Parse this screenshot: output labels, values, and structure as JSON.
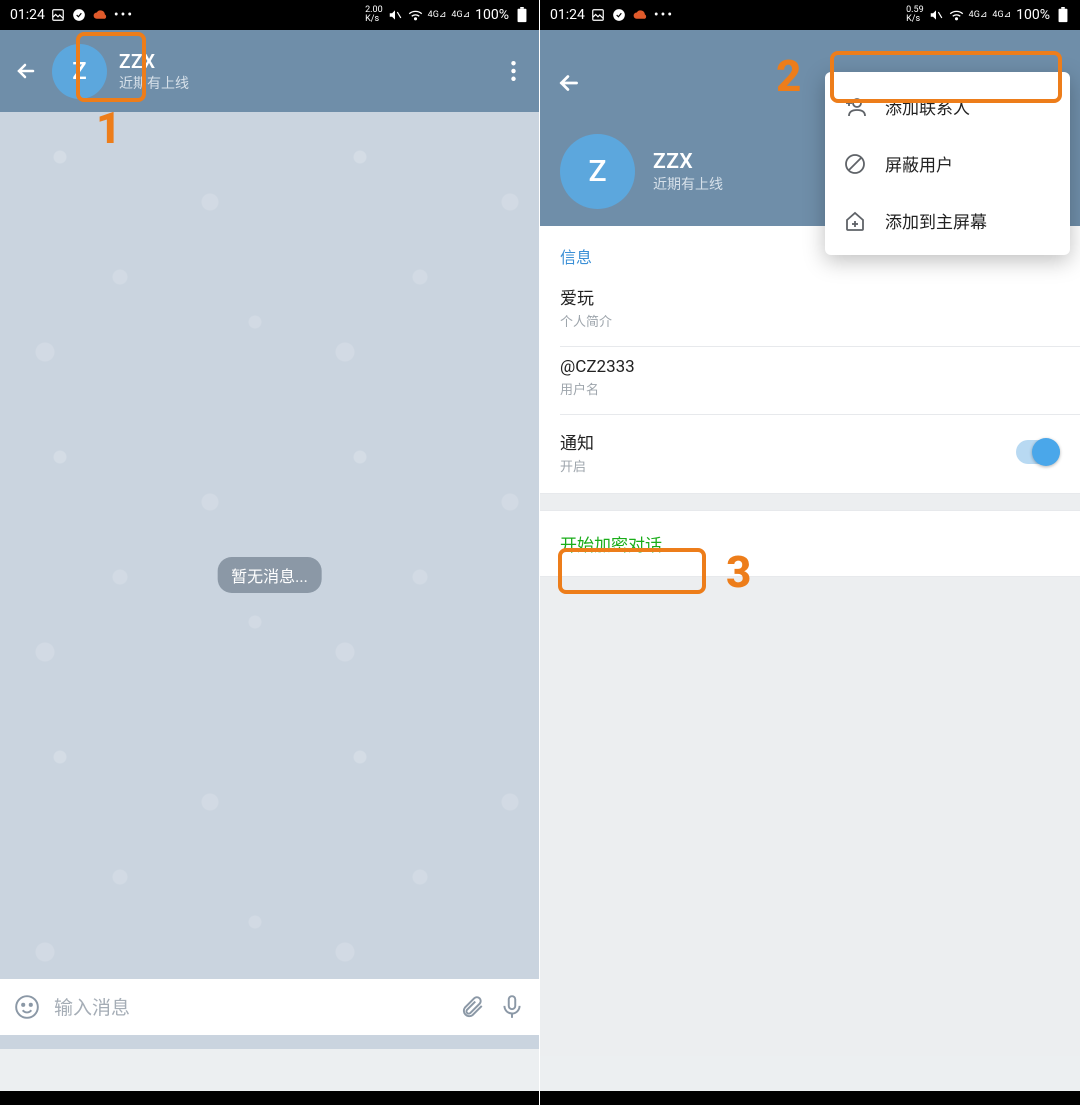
{
  "statusbar": {
    "time": "01:24",
    "kbs_left": "2.00",
    "kbs_right": "0.59",
    "kbs_unit": "K/s",
    "net_label": "4G",
    "battery_pct": "100%"
  },
  "chat": {
    "name": "ZZX",
    "status": "近期有上线",
    "avatar_letter": "Z",
    "empty_message": "暂无消息...",
    "input_placeholder": "输入消息"
  },
  "profile": {
    "name": "ZZX",
    "status": "近期有上线",
    "avatar_letter": "Z",
    "section_info_title": "信息",
    "bio_value": "爱玩",
    "bio_label": "个人简介",
    "username_value": "@CZ2333",
    "username_label": "用户名",
    "notif_title": "通知",
    "notif_state": "开启",
    "secret_chat_label": "开始加密对话"
  },
  "menu": {
    "add_contact": "添加联系人",
    "block_user": "屏蔽用户",
    "add_home": "添加到主屏幕"
  },
  "annotations": {
    "n1": "1",
    "n2": "2",
    "n3": "3"
  }
}
